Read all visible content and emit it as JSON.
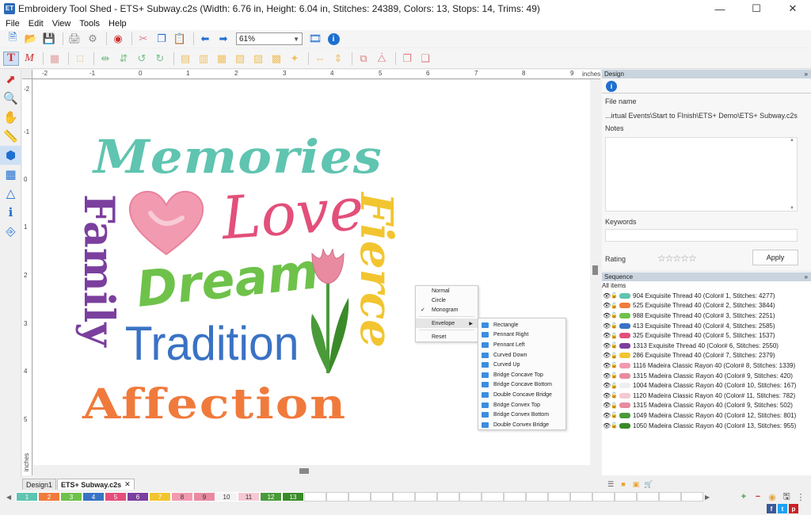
{
  "window": {
    "title": "Embroidery Tool Shed - ETS+ Subway.c2s (Width: 6.76 in, Height: 6.04 in, Stitches: 24389, Colors: 13, Stops: 14, Trims: 49)",
    "app_icon_text": "ET"
  },
  "menu": [
    "File",
    "Edit",
    "View",
    "Tools",
    "Help"
  ],
  "toolbar": {
    "zoom_value": "61%"
  },
  "rulers": {
    "h_ticks": [
      "-2",
      "-1",
      "0",
      "1",
      "2",
      "3",
      "4",
      "5",
      "6",
      "7",
      "8",
      "9"
    ],
    "v_ticks": [
      "-2",
      "-1",
      "0",
      "1",
      "2",
      "3",
      "4",
      "5"
    ],
    "units_label": "inches"
  },
  "design_text": {
    "memories": "Memories",
    "love": "Love",
    "family": "Family",
    "dream": "Dream",
    "tradition": "Tradition",
    "fierce": "Fierce",
    "affection": "Affection"
  },
  "colors": {
    "memories": "#5fc4b0",
    "love": "#e34f7a",
    "family": "#7b3f9e",
    "dream": "#6ec24a",
    "tradition": "#3a72c4",
    "fierce": "#f2c530",
    "affection": "#f07a3c",
    "heart": "#f29ab0"
  },
  "context_menu": {
    "items": [
      "Normal",
      "Circle",
      "Monogram",
      "Envelope",
      "Reset"
    ],
    "checked": "Monogram",
    "submenu_parent": "Envelope",
    "submenu": [
      "Rectangle",
      "Pennant Right",
      "Pennant Left",
      "Curved Down",
      "Curved Up",
      "Bridge Concave Top",
      "Bridge Concave Bottom",
      "Double Concave Bridge",
      "Bridge Convex Top",
      "Bridge Convex Bottom",
      "Double Convex Bridge"
    ]
  },
  "design_panel": {
    "header": "Design",
    "collapse": "»",
    "file_name_label": "File name",
    "file_name_value": "...irtual Events\\Start to FInish\\ETS+ Demo\\ETS+ Subway.c2s",
    "notes_label": "Notes",
    "keywords_label": "Keywords",
    "rating_label": "Rating",
    "apply_label": "Apply"
  },
  "sequence_panel": {
    "header": "Sequence",
    "collapse": "»",
    "all_items": "All items",
    "rows": [
      {
        "text": "904 Exquisite Thread 40 (Color# 1, Stitches: 4277)",
        "color": "#5fc4b0"
      },
      {
        "text": "525 Exquisite Thread 40 (Color# 2, Stitches: 3844)",
        "color": "#f07a3c"
      },
      {
        "text": "988 Exquisite Thread 40 (Color# 3, Stitches: 2251)",
        "color": "#6ec24a"
      },
      {
        "text": "413 Exquisite Thread 40 (Color# 4, Stitches: 2585)",
        "color": "#3a72c4"
      },
      {
        "text": "325 Exquisite Thread 40 (Color# 5, Stitches: 1537)",
        "color": "#e34f7a"
      },
      {
        "text": "1313 Exquisite Thread 40 (Color# 6, Stitches: 2550)",
        "color": "#7b3f9e"
      },
      {
        "text": "286 Exquisite Thread 40 (Color# 7, Stitches: 2379)",
        "color": "#f2c530"
      },
      {
        "text": "1116 Madeira Classic Rayon 40 (Color# 8, Stitches: 1339)",
        "color": "#f29ab0"
      },
      {
        "text": "1315 Madeira Classic Rayon 40 (Color# 9, Stitches: 420)",
        "color": "#e88aa0"
      },
      {
        "text": "1004 Madeira Classic Rayon 40 (Color# 10, Stitches: 167)",
        "color": "#eeeeee"
      },
      {
        "text": "1120 Madeira Classic Rayon 40 (Color# 11, Stitches: 782)",
        "color": "#f5c8d4"
      },
      {
        "text": "1315 Madeira Classic Rayon 40 (Color# 9, Stitches: 502)",
        "color": "#e88aa0"
      },
      {
        "text": "1049 Madeira Classic Rayon 40 (Color# 12, Stitches: 801)",
        "color": "#4a9a3a"
      },
      {
        "text": "1050 Madeira Classic Rayon 40 (Color# 13, Stitches: 955)",
        "color": "#3a8a2a"
      }
    ]
  },
  "doc_tabs": [
    "Design1",
    "ETS+ Subway.c2s"
  ],
  "doc_tab_close": "✕",
  "palette": [
    {
      "num": "1",
      "color": "#5fc4b0"
    },
    {
      "num": "2",
      "color": "#f07a3c"
    },
    {
      "num": "3",
      "color": "#6ec24a"
    },
    {
      "num": "4",
      "color": "#3a72c4"
    },
    {
      "num": "5",
      "color": "#e34f7a"
    },
    {
      "num": "6",
      "color": "#7b3f9e"
    },
    {
      "num": "7",
      "color": "#f2c530"
    },
    {
      "num": "8",
      "color": "#f29ab0"
    },
    {
      "num": "9",
      "color": "#e88aa0"
    },
    {
      "num": "10",
      "color": "#f4f4f4"
    },
    {
      "num": "11",
      "color": "#f5c8d4"
    },
    {
      "num": "12",
      "color": "#4a9a3a"
    },
    {
      "num": "13",
      "color": "#3a8a2a"
    }
  ]
}
